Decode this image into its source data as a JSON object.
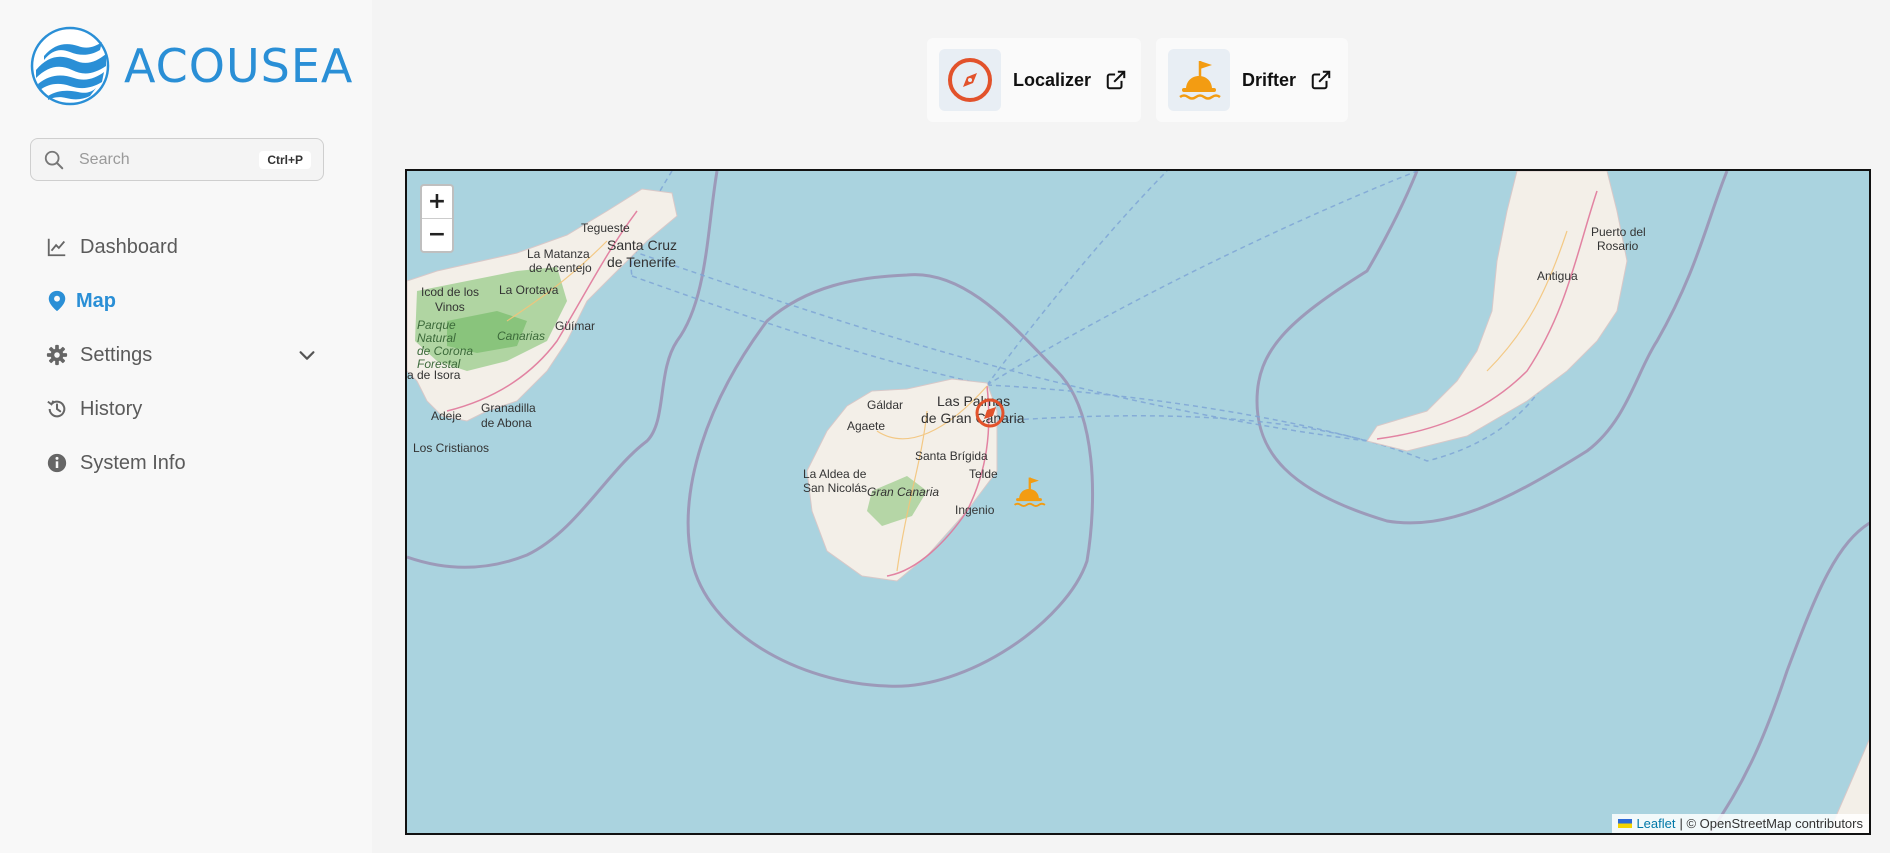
{
  "app": {
    "name": "ACOUSEA",
    "brand_color": "#2a8fd6"
  },
  "search": {
    "placeholder": "Search",
    "shortcut": "Ctrl+P"
  },
  "nav": {
    "items": [
      {
        "label": "Dashboard",
        "icon": "chart-line-icon",
        "active": false
      },
      {
        "label": "Map",
        "icon": "map-pin-icon",
        "active": true
      },
      {
        "label": "Settings",
        "icon": "gear-icon",
        "active": false,
        "expandable": true
      },
      {
        "label": "History",
        "icon": "history-icon",
        "active": false
      },
      {
        "label": "System Info",
        "icon": "info-icon",
        "active": false
      }
    ]
  },
  "toolbar": {
    "buttons": [
      {
        "label": "Localizer",
        "icon": "compass-icon"
      },
      {
        "label": "Drifter",
        "icon": "buoy-icon"
      }
    ]
  },
  "map": {
    "zoom_in": "+",
    "zoom_out": "−",
    "attribution_link": "Leaflet",
    "attribution_text": "| © OpenStreetMap contributors",
    "labels": {
      "teguiste": "Tegueste",
      "santa_cruz_1": "Santa Cruz",
      "santa_cruz_2": "de Tenerife",
      "la_matanza_1": "La Matanza",
      "la_matanza_2": "de Acentejo",
      "icod_1": "Icod de los",
      "icod_2": "Vinos",
      "la_orotava": "La Orotava",
      "parque_1": "Parque",
      "parque_2": "Natural",
      "parque_3": "de Corona",
      "parque_4": "Forestal",
      "canarias": "Canarias",
      "guimar": "Güímar",
      "isora": "a de Isora",
      "adeje": "Adeje",
      "granadilla_1": "Granadilla",
      "granadilla_2": "de Abona",
      "los_cristianos": "Los Cristianos",
      "galdar": "Gáldar",
      "agaete": "Agaete",
      "las_palmas_1": "Las Palmas",
      "las_palmas_2": "de Gran Canaria",
      "santa_brigida": "Santa Brígida",
      "telde": "Telde",
      "la_aldea_1": "La Aldea de",
      "la_aldea_2": "San Nicolás",
      "gran_canaria": "Gran Canaria",
      "ingenio": "Ingenio",
      "puerto_1": "Puerto del",
      "puerto_2": "Rosario",
      "antigua": "Antigua"
    }
  }
}
